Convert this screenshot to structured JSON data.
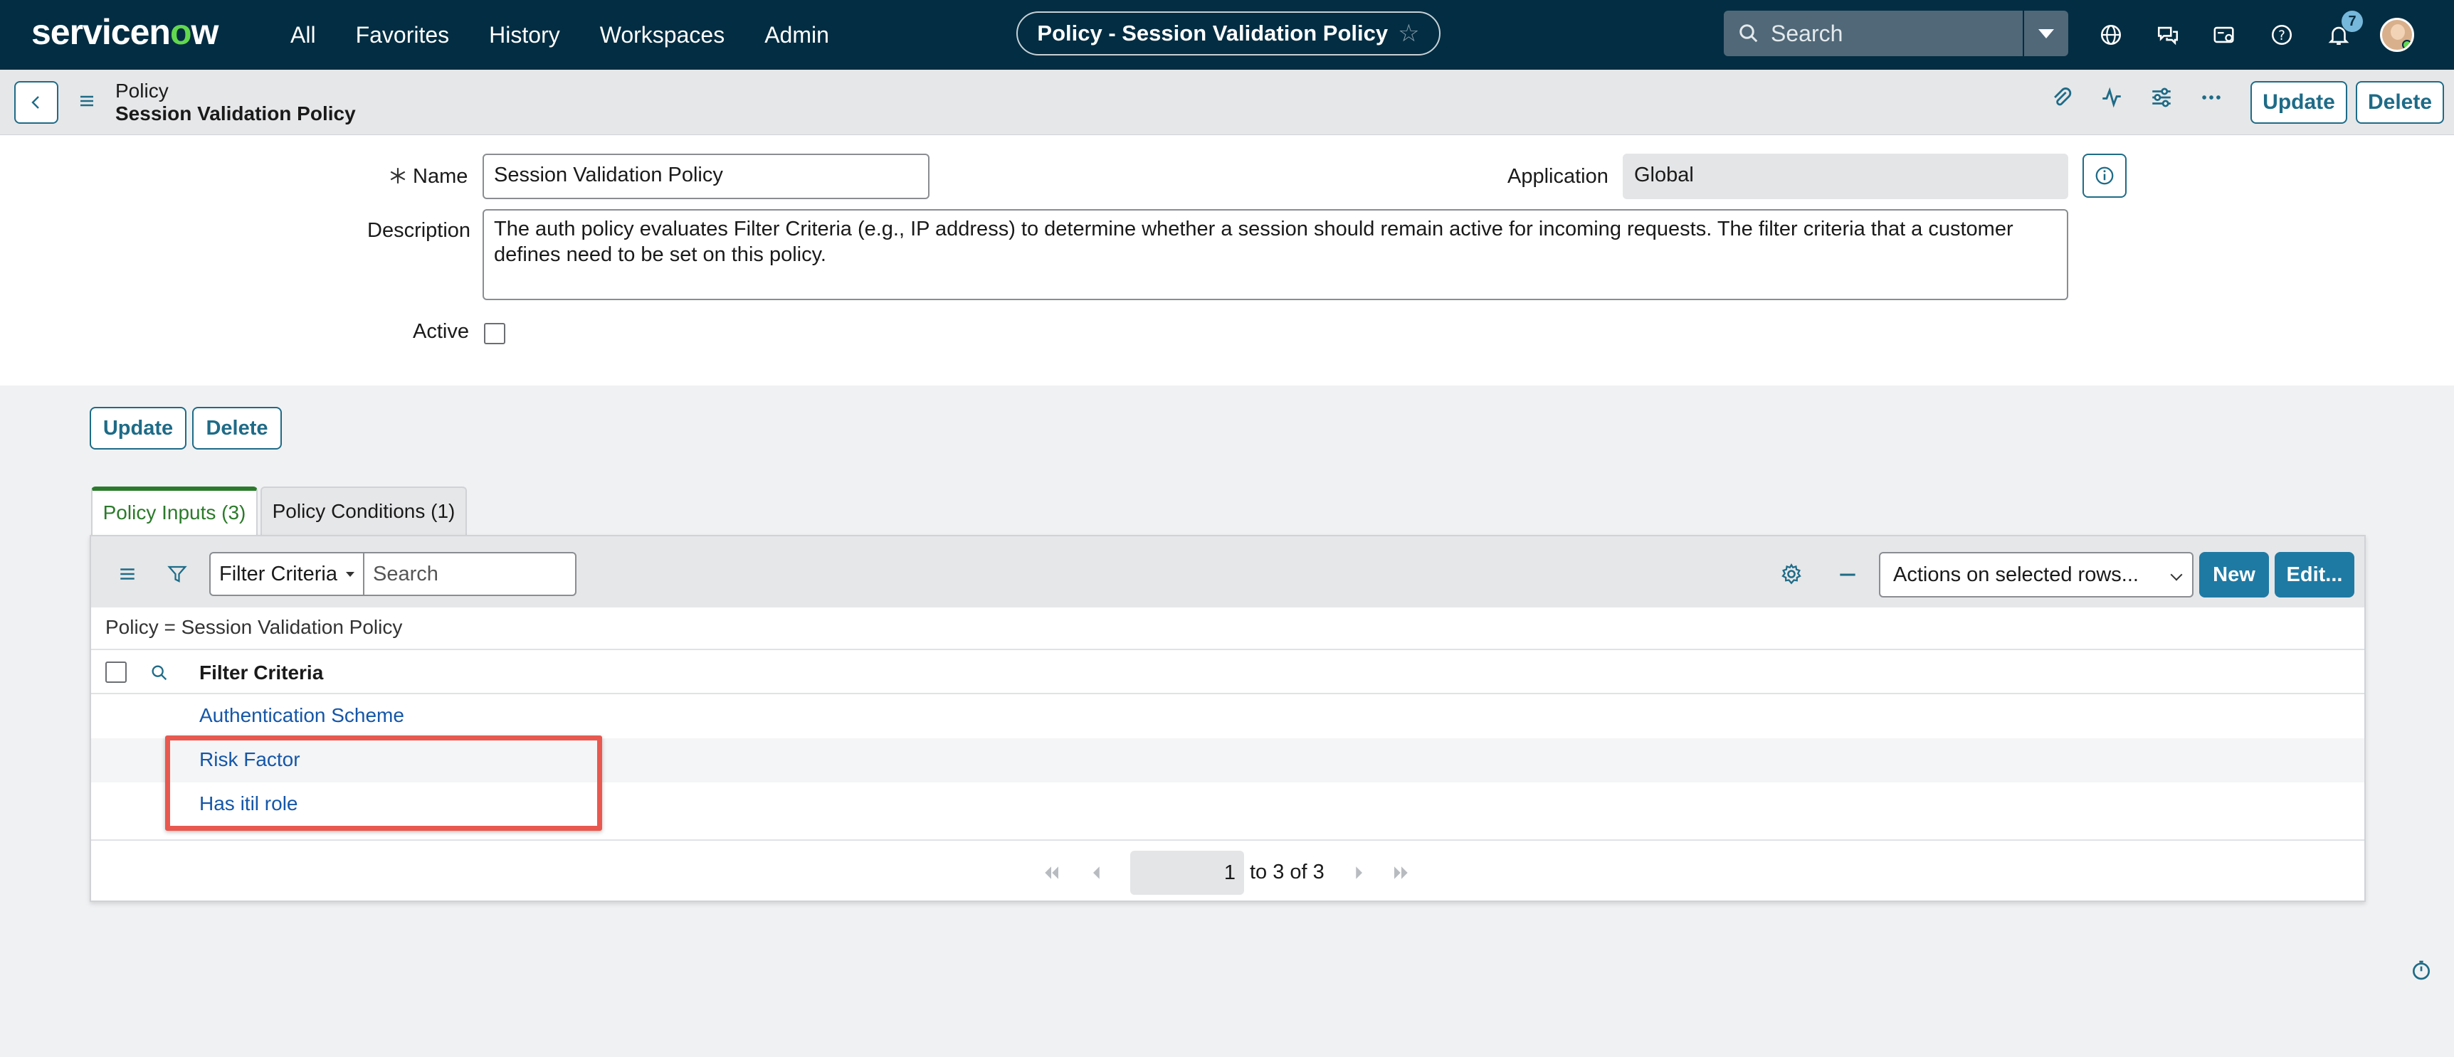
{
  "nav": {
    "logo": "servicenow",
    "menu": [
      "All",
      "Favorites",
      "History",
      "Workspaces",
      "Admin"
    ],
    "title": "Policy - Session Validation Policy",
    "search_placeholder": "Search",
    "notification_count": "7"
  },
  "header": {
    "table": "Policy",
    "record": "Session Validation Policy",
    "update_label": "Update",
    "delete_label": "Delete"
  },
  "form": {
    "name_label": "Name",
    "name_value": "Session Validation Policy",
    "application_label": "Application",
    "application_value": "Global",
    "description_label": "Description",
    "description_value": "The auth policy evaluates Filter Criteria (e.g., IP address) to determine whether a session should remain active for incoming requests.  The filter criteria that a customer defines need to be set on this policy.",
    "active_label": "Active",
    "active_checked": false,
    "update_label": "Update",
    "delete_label": "Delete"
  },
  "tabs": [
    {
      "label": "Policy Inputs (3)",
      "active": true
    },
    {
      "label": "Policy Conditions (1)",
      "active": false
    }
  ],
  "list": {
    "filter_field": "Filter Criteria",
    "search_placeholder": "Search",
    "actions_label": "Actions on selected rows...",
    "new_label": "New",
    "edit_label": "Edit...",
    "breadcrumb": "Policy = Session Validation Policy",
    "column_header": "Filter Criteria",
    "rows": [
      "Authentication Scheme",
      "Risk Factor",
      "Has itil role"
    ],
    "page_value": "1",
    "page_text": "to 3 of 3"
  },
  "colors": {
    "nav_bg": "#032d42",
    "accent": "#1e6b87",
    "primary_button": "#1e7aa3",
    "link": "#1556a8",
    "active_tab": "#2b7a2b",
    "highlight": "#e8584e"
  }
}
